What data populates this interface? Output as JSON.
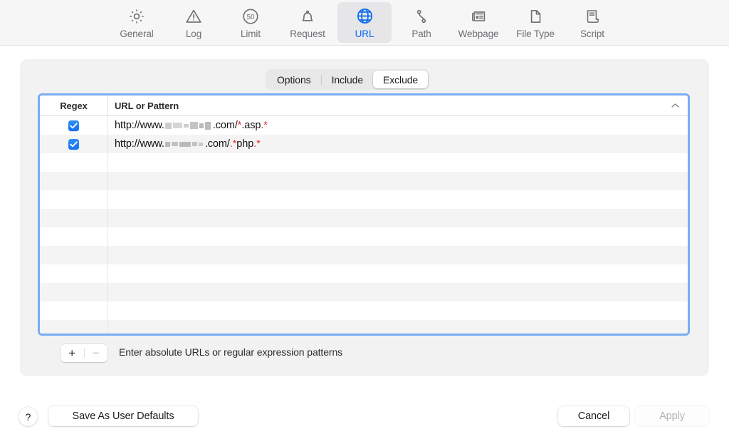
{
  "toolbar": {
    "tabs": [
      {
        "label": "General",
        "icon": "gear-icon",
        "selected": false
      },
      {
        "label": "Log",
        "icon": "warning-icon",
        "selected": false
      },
      {
        "label": "Limit",
        "icon": "speed-50-icon",
        "selected": false
      },
      {
        "label": "Request",
        "icon": "bell-icon",
        "selected": false
      },
      {
        "label": "URL",
        "icon": "globe-icon",
        "selected": true
      },
      {
        "label": "Path",
        "icon": "path-icon",
        "selected": false
      },
      {
        "label": "Webpage",
        "icon": "webpage-icon",
        "selected": false
      },
      {
        "label": "File Type",
        "icon": "document-icon",
        "selected": false
      },
      {
        "label": "Script",
        "icon": "script-icon",
        "selected": false
      }
    ],
    "limit_icon_value": "50",
    "selected_color": "#0b6bf2"
  },
  "segmented": {
    "options": [
      "Options",
      "Include",
      "Exclude"
    ],
    "selected": "Exclude"
  },
  "table": {
    "columns": [
      "Regex",
      "URL or Pattern"
    ],
    "sort_indicator": "chevron-up-icon",
    "regex_color": "#e8312a",
    "checkbox_color": "#1073f0",
    "rows": [
      {
        "regex_checked": true,
        "segments": [
          {
            "text": "http://www.",
            "regex": false
          },
          {
            "redacted": true,
            "blocks": [
              [
                9,
                9
              ],
              [
                13,
                8
              ],
              [
                7,
                5
              ],
              [
                11,
                10
              ],
              [
                6,
                7
              ],
              [
                8,
                11
              ]
            ]
          },
          {
            "text": ".com/",
            "regex": false
          },
          {
            "text": "*",
            "regex": true
          },
          {
            "text": ".asp",
            "regex": false
          },
          {
            "text": ".",
            "regex": true
          },
          {
            "text": "*",
            "regex": true
          }
        ]
      },
      {
        "regex_checked": true,
        "segments": [
          {
            "text": "http://www.",
            "regex": false
          },
          {
            "redacted": true,
            "blocks": [
              [
                7,
                7
              ],
              [
                9,
                6
              ],
              [
                16,
                7
              ],
              [
                7,
                6
              ],
              [
                6,
                5
              ]
            ]
          },
          {
            "text": ".com/",
            "regex": false
          },
          {
            "text": ".",
            "regex": true
          },
          {
            "text": "*",
            "regex": true
          },
          {
            "text": "php",
            "regex": false
          },
          {
            "text": ".",
            "regex": true
          },
          {
            "text": "*",
            "regex": true
          }
        ]
      }
    ],
    "blank_row_count": 10
  },
  "list_controls": {
    "add_label": "+",
    "remove_label": "−",
    "add_enabled": true,
    "remove_enabled": false,
    "hint": "Enter absolute URLs or regular expression patterns"
  },
  "footer": {
    "help_label": "?",
    "save_defaults_label": "Save As User Defaults",
    "cancel_label": "Cancel",
    "apply_label": "Apply",
    "apply_enabled": false
  }
}
